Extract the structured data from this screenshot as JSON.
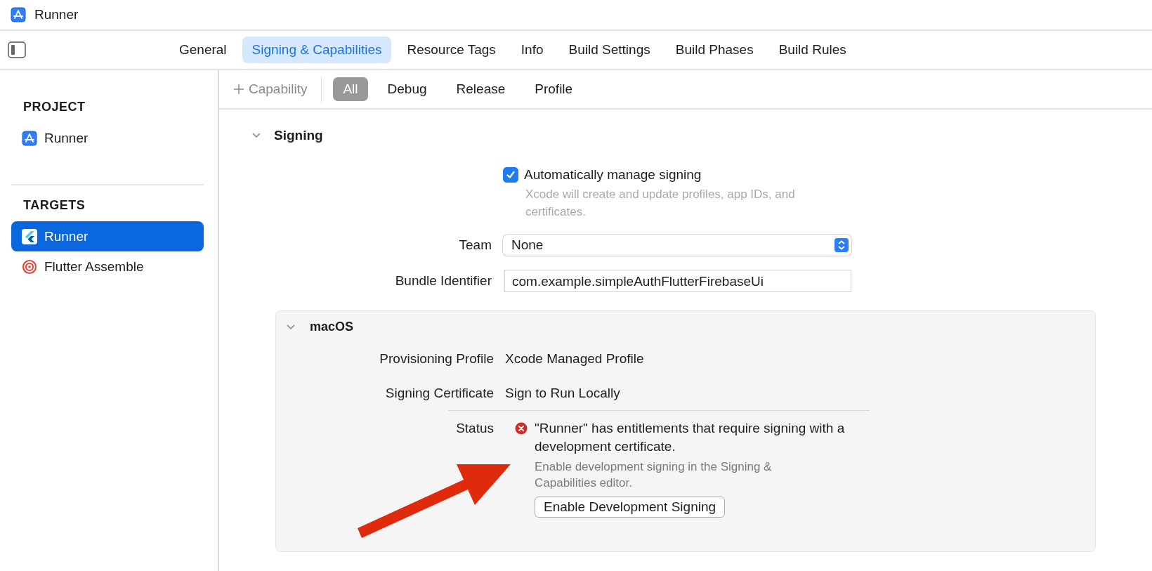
{
  "window": {
    "title": "Runner"
  },
  "editor_tabs": [
    {
      "label": "General",
      "selected": false
    },
    {
      "label": "Signing & Capabilities",
      "selected": true
    },
    {
      "label": "Resource Tags",
      "selected": false
    },
    {
      "label": "Info",
      "selected": false
    },
    {
      "label": "Build Settings",
      "selected": false
    },
    {
      "label": "Build Phases",
      "selected": false
    },
    {
      "label": "Build Rules",
      "selected": false
    }
  ],
  "sidebar": {
    "sections": [
      {
        "heading": "PROJECT",
        "items": [
          {
            "label": "Runner",
            "kind": "project",
            "selected": false
          }
        ]
      },
      {
        "heading": "TARGETS",
        "items": [
          {
            "label": "Runner",
            "kind": "flutter",
            "selected": true
          },
          {
            "label": "Flutter Assemble",
            "kind": "target",
            "selected": false
          }
        ]
      }
    ]
  },
  "filter_bar": {
    "add_button": {
      "label": "Capability",
      "disabled": true
    },
    "filters": [
      {
        "label": "All",
        "selected": true
      },
      {
        "label": "Debug",
        "selected": false
      },
      {
        "label": "Release",
        "selected": false
      },
      {
        "label": "Profile",
        "selected": false
      }
    ]
  },
  "signing": {
    "title": "Signing",
    "expanded": true,
    "auto_manage": {
      "label": "Automatically manage signing",
      "checked": true,
      "hint": "Xcode will create and update profiles, app IDs, and certificates."
    },
    "fields": [
      {
        "kind": "popup",
        "label": "Team",
        "value": "None"
      },
      {
        "kind": "text",
        "label": "Bundle Identifier",
        "value": "com.example.simpleAuthFlutterFirebaseUi"
      }
    ],
    "platform": {
      "title": "macOS",
      "expanded": true,
      "rows": [
        {
          "label": "Provisioning Profile",
          "value": "Xcode Managed Profile"
        },
        {
          "label": "Signing Certificate",
          "value": "Sign to Run Locally"
        }
      ],
      "status": {
        "label": "Status",
        "kind": "error",
        "message": "\"Runner\" has entitlements that require signing with a development certificate.",
        "detail": "Enable development signing in the Signing & Capabilities editor.",
        "button": "Enable Development Signing"
      }
    }
  }
}
